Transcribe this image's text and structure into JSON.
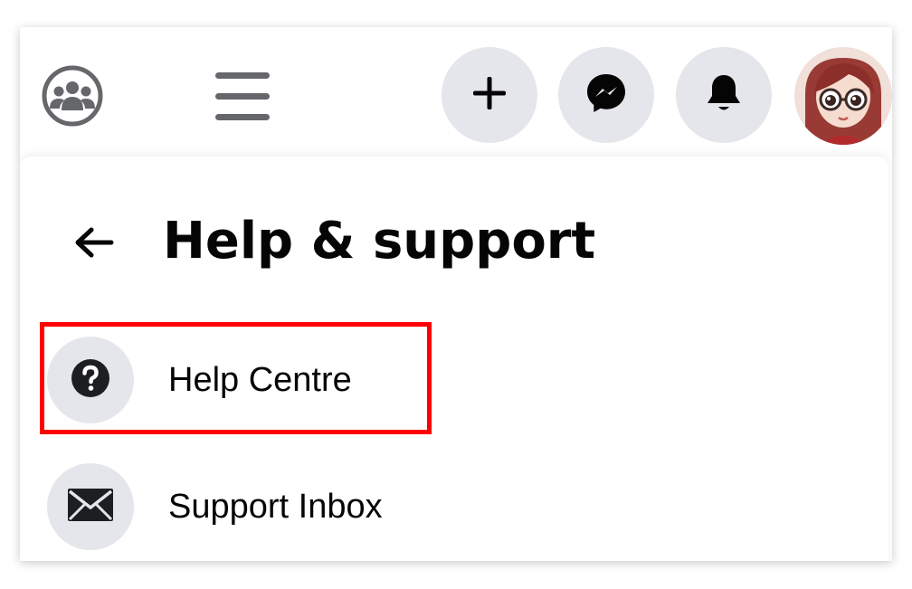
{
  "colors": {
    "circle_bg": "#e4e6eb",
    "icon_dark": "#050505",
    "icon_gray": "#65676b",
    "text": "#050505",
    "highlight": "#ff0000"
  },
  "header": {
    "icons": {
      "groups": "groups-icon",
      "menu": "hamburger-menu-icon",
      "create": "plus-icon",
      "messenger": "messenger-icon",
      "notifications": "bell-icon",
      "avatar": "profile-avatar"
    }
  },
  "panel": {
    "back_icon": "back-arrow-icon",
    "title": "Help & support",
    "items": [
      {
        "label": "Help Centre",
        "icon": "question-mark-icon",
        "highlighted": true
      },
      {
        "label": "Support Inbox",
        "icon": "envelope-icon",
        "highlighted": false
      }
    ]
  }
}
